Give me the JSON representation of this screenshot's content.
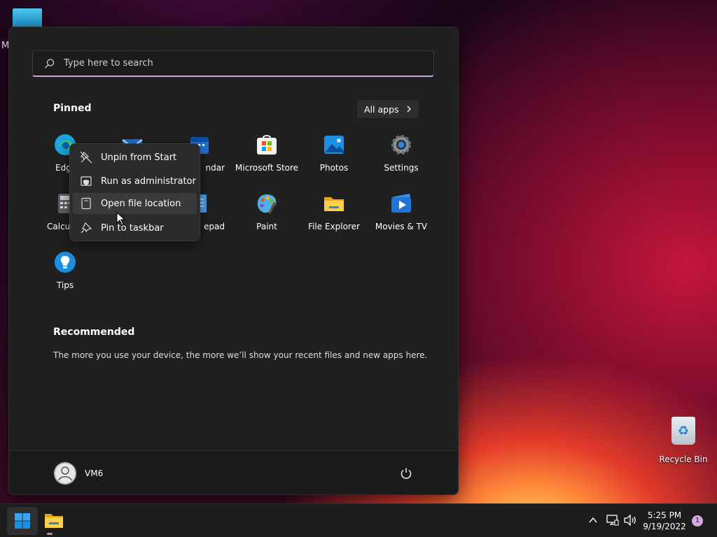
{
  "desktop": {
    "folder_label": "M",
    "recycle_bin_label": "Recycle Bin"
  },
  "start_menu": {
    "search_placeholder": "Type here to search",
    "pinned_title": "Pinned",
    "all_apps_label": "All apps",
    "pinned_apps": [
      {
        "label": "Edg",
        "icon": "edge-icon"
      },
      {
        "label": "",
        "icon": "mail-icon"
      },
      {
        "label": "ndar",
        "icon": "calendar-icon"
      },
      {
        "label": "Microsoft Store",
        "icon": "store-icon"
      },
      {
        "label": "Photos",
        "icon": "photos-icon"
      },
      {
        "label": "Settings",
        "icon": "gear-icon"
      },
      {
        "label": "Calcul",
        "icon": "calculator-icon"
      },
      {
        "label": "",
        "icon": "app-icon"
      },
      {
        "label": "epad",
        "icon": "notepad-icon"
      },
      {
        "label": "Paint",
        "icon": "paint-icon"
      },
      {
        "label": "File Explorer",
        "icon": "folder-icon"
      },
      {
        "label": "Movies & TV",
        "icon": "movies-icon"
      },
      {
        "label": "Tips",
        "icon": "tips-icon"
      }
    ],
    "recommended_title": "Recommended",
    "recommended_text": "The more you use your device, the more we’ll show your recent files and new apps here.",
    "user_name": "VM6"
  },
  "context_menu": {
    "items": [
      {
        "label": "Unpin from Start",
        "icon": "unpin-icon"
      },
      {
        "label": "Run as administrator",
        "icon": "shield-icon"
      },
      {
        "label": "Open file location",
        "icon": "file-location-icon"
      },
      {
        "label": "Pin to taskbar",
        "icon": "pin-icon"
      }
    ],
    "hovered_index": 2
  },
  "taskbar": {
    "time": "5:25 PM",
    "date": "9/19/2022",
    "notification_count": "1"
  },
  "colors": {
    "accent": "#c7a6e6",
    "menu_bg": "#202020"
  }
}
